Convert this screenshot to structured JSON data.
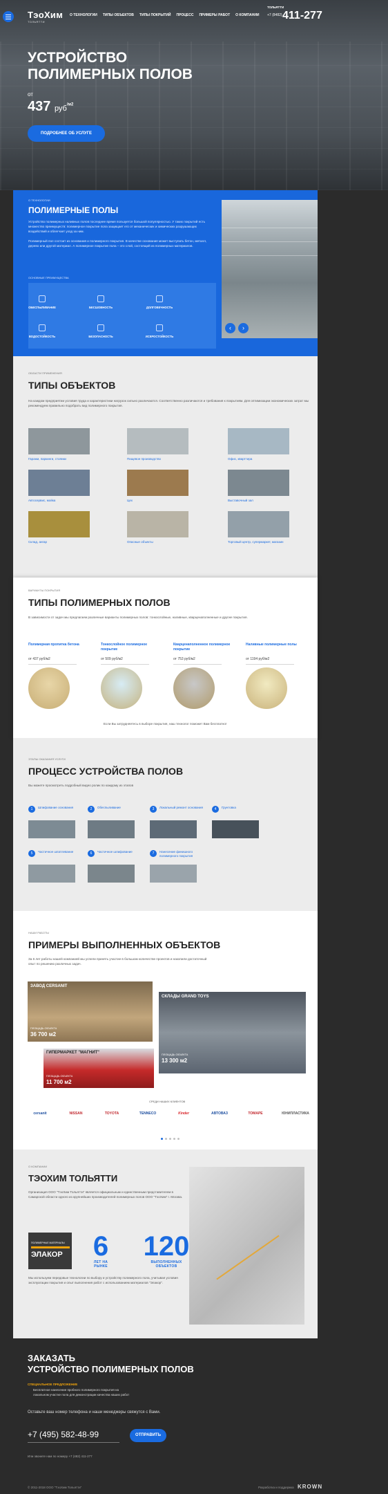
{
  "hero": {
    "logo": "ТэоХим",
    "logo_sub": "ТОЛЬЯТТИ",
    "nav": [
      "О ТЕХНОЛОГИИ",
      "ТИПЫ ОБЪЕКТОВ",
      "ТИПЫ ПОКРЫТИЙ",
      "ПРОЦЕСС",
      "ПРИМЕРЫ РАБОТ",
      "О КОМПАНИИ"
    ],
    "city": "ТОЛЬЯТТИ",
    "phone_code": "+7 (8482)",
    "phone": "411-277",
    "title_line1": "УСТРОЙСТВО",
    "title_line2": "ПОЛИМЕРНЫХ ПОЛОВ",
    "from": "от",
    "price": "437",
    "price_unit": "руб",
    "price_per": "/м2",
    "button": "ПОДРОБНЕЕ ОБ УСЛУГЕ"
  },
  "poly": {
    "label": "О ТЕХНОЛОГИИ",
    "title": "ПОЛИМЕРНЫЕ ПОЛЫ",
    "p1": "Устройство полимерных наливных полов последнее время пользуется большой популярностью. У таких покрытий есть множество преимуществ: полимерное покрытие пола защищает его от механических и химических разрушающих воздействий и облегчает уход за ним.",
    "p2": "Полимерный пол состоит из основания и полимерного покрытия. В качестве основания может выступать бетон, металл, дерево или другой материал. А полимерное покрытие пола – это слой, состоящий из полимерных материалов.",
    "adv_label": "ОСНОВНЫЕ ПРЕИМУЩЕСТВА",
    "advantages": [
      "ОБЕСПЫЛИВАНИЕ",
      "БЕСШОВНОСТЬ",
      "ДОЛГОВЕЧНОСТЬ",
      "ВОДОСТОЙКОСТЬ",
      "БЕЗОПАСНОСТЬ",
      "ИСКРОСТОЙКОСТЬ"
    ],
    "prev": "‹",
    "next": "›"
  },
  "objects": {
    "label": "ОБЛАСТИ ПРИМЕНЕНИЯ",
    "title": "ТИПЫ ОБЪЕКТОВ",
    "p": "На каждом предприятии условия труда и характеристики нагрузок сильно различаются. Соответственно различаются и требования к покрытиям. Для оптимизации экономических затрат мы рекомендуем правильно подобрать вид полимерного покрытия.",
    "items": [
      "Гаражи, паркинги, стоянки",
      "Пищевое производство",
      "Офис, кварттира",
      "Автосервис, мойка",
      "Цех",
      "Выставочный зал",
      "Склад, ангар",
      "Опасные объекты",
      "Торговый центр, супермаркет, магазин"
    ]
  },
  "types": {
    "label": "ВАРИАНТЫ ПОКРЫТИЯ",
    "title": "ТИПЫ ПОЛИМЕРНЫХ ПОЛОВ",
    "p": "В зависимости от задач мы предлагаем различные варианты полимерных полов: тонкослойные, наливные, кварценаполненные и другие покрытия.",
    "items": [
      {
        "title": "Полимерная пропитка бетона",
        "price": "от 437 руб/м2"
      },
      {
        "title": "Тонкослойное полимерное покрытие",
        "price": "от 509 руб/м2"
      },
      {
        "title": "Кварценаполненное полимерное покрытие",
        "price": "от 753 руб/м2"
      },
      {
        "title": "Наливные полимерные полы",
        "price": "от 1194 руб/м2"
      }
    ],
    "note": "Если Вы затрудняетесь в выборе покрытия, наш технолог поможет Вам бесплатно!"
  },
  "process": {
    "label": "ЭТАПЫ ОКАЗАНИЯ УСЛУГИ",
    "title": "ПРОЦЕСС УСТРОЙСТВА ПОЛОВ",
    "p": "Вы можете просмотреть подробный видео ролик по каждому из этапов",
    "steps": [
      {
        "n": "1",
        "t": "Шлифование основания"
      },
      {
        "n": "2",
        "t": "Обеспыливание"
      },
      {
        "n": "3",
        "t": "Локальный ремонт основания"
      },
      {
        "n": "4",
        "t": "Грунтовка"
      },
      {
        "n": "5",
        "t": "Частичное шпатлевание"
      },
      {
        "n": "6",
        "t": "Частичное шлифование"
      },
      {
        "n": "7",
        "t": "Нанесение финишного полимерного покрытия"
      }
    ]
  },
  "works": {
    "label": "НАШИ РАБОТЫ",
    "title": "ПРИМЕРЫ ВЫПОЛНЕННЫХ ОБЪЕКТОВ",
    "p": "За 6 лет работы нашей компанией мы успели принять участие в большом количестве проектов и накопили достаточный опыт по решению различных задач.",
    "cases": [
      {
        "name": "ЗАВОД CERSANIT",
        "area_label": "ПЛОЩАДЬ ОБЪЕКТА",
        "area": "36 700 м2"
      },
      {
        "name": "СКЛАДЫ GRAND TOYS",
        "area_label": "ПЛОЩАДЬ ОБЪЕКТА",
        "area": "13 300 м2"
      },
      {
        "name": "ГИПЕРМАРКЕТ \"МАГНИТ\"",
        "area_label": "ПЛОЩАДЬ ОБЪЕКТА",
        "area": "11 700 м2"
      }
    ],
    "clients_label": "СРЕДИ НАШИХ КЛИЕНТОВ",
    "clients": [
      "cersanit",
      "NISSAN",
      "TOYOTA",
      "TENNECO",
      "Kinder",
      "АВТОВАЗ",
      "ТОМАРЕ",
      "ЮНИПЛАСТИКА"
    ]
  },
  "company": {
    "label": "О КОМПАНИИ",
    "title": "ТЭОХИМ ТОЛЬЯТТИ",
    "p1": "Организация ООО \"ТэоХим Тольятти\" является официальным и единственным представителем в Самарской области одного из крупнейших производителей полимерных полов ООО \"ТэоХим\" г. Москва.",
    "p2": "Мы используем передовые технологии по выбору и устройству полимерного пола, учитывая условия эксплуатации покрытия и опыт выполнения работ с использованием материалов \"Элакор\".",
    "badge": "ЭЛАКОР",
    "badge_top": "ПОЛИМЕРНЫЕ МАТЕРИАЛЫ",
    "years": "6",
    "years_label": "ЛЕТ НА РЫНКЕ",
    "objects": "120",
    "objects_label": "ВЫПОЛНЕННЫХ ОБЪЕКТОВ"
  },
  "order": {
    "title_line1": "ЗАКАЗАТЬ",
    "title_line2": "УСТРОЙСТВО ПОЛИМЕРНЫХ ПОЛОВ",
    "special_label": "СПЕЦИАЛЬНОЕ ПРЕДЛОЖЕНИЕ",
    "special": "Бесплатное нанесение пробного полимерного покрытия на локальном участке пола для демонстрации качества наших работ",
    "hint": "Оставьте ваш номер телефона и наши менеджеры свяжутся с Вами.",
    "phone_placeholder": "+7 (495) 582-48-99",
    "button": "ОТПРАВИТЬ",
    "alt": "Или звоните нам по номеру +7 (482) 411-277"
  },
  "footer": {
    "copyright": "© 2011-2018 ООО \"ТэоХим Тольятти\"",
    "dev": "Разработка и поддержка",
    "dev_brand": "KROWN"
  },
  "colors": {
    "accent": "#1a6be0",
    "dark": "#2b2b2b",
    "panel": "#ececec"
  }
}
